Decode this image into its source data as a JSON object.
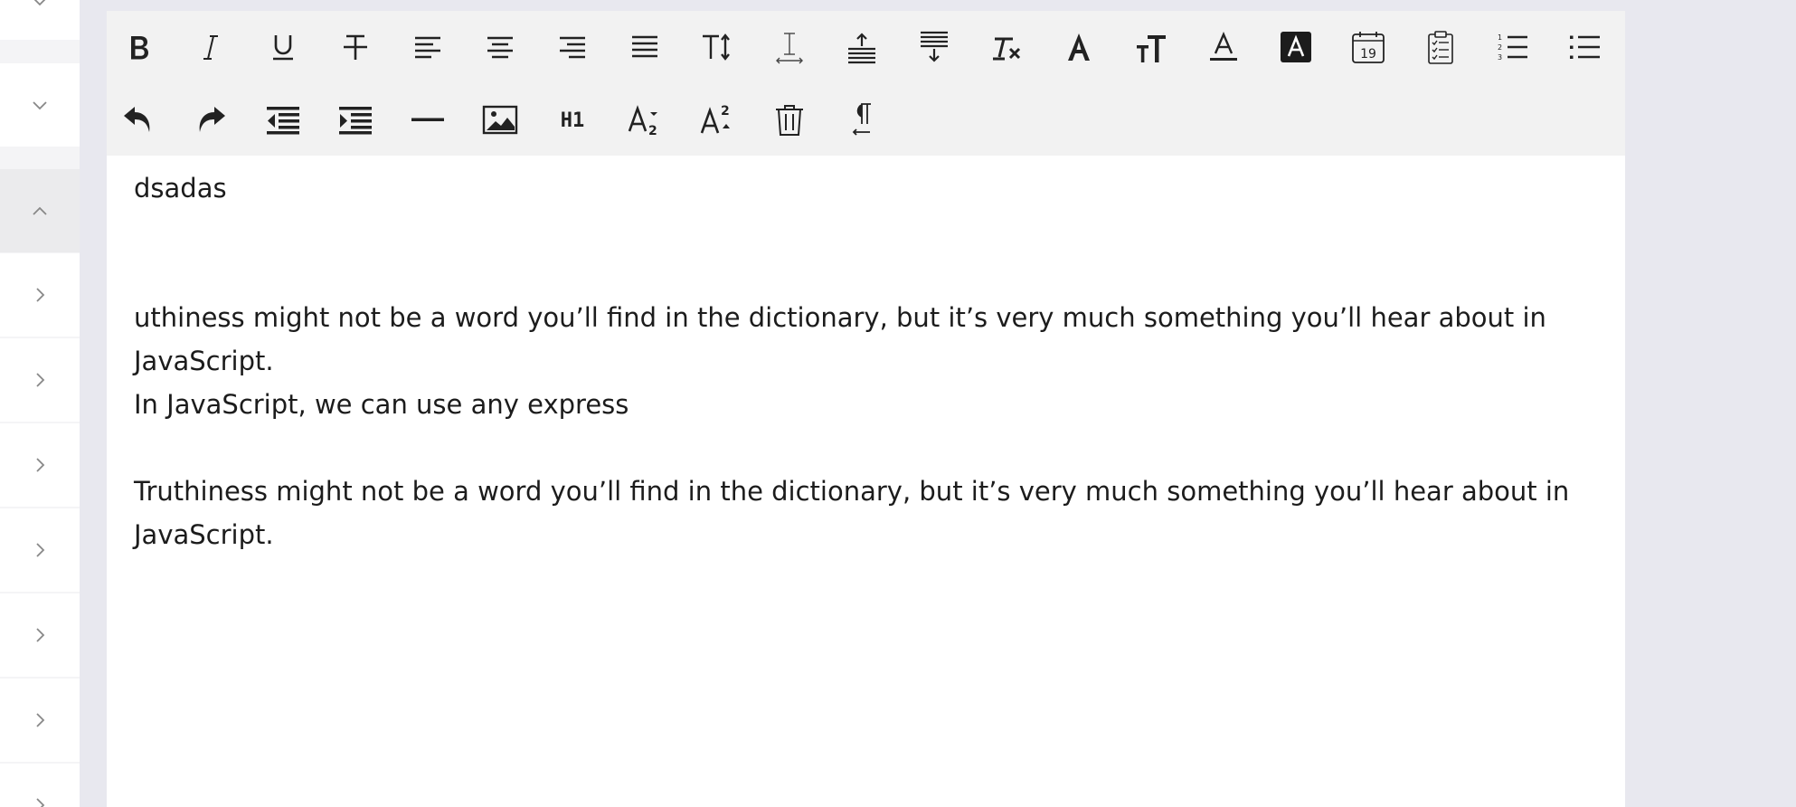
{
  "toolbar": {
    "row1": [
      {
        "name": "bold-icon"
      },
      {
        "name": "italic-icon"
      },
      {
        "name": "underline-icon"
      },
      {
        "name": "strikethrough-icon"
      },
      {
        "name": "align-left-icon"
      },
      {
        "name": "align-center-icon"
      },
      {
        "name": "align-right-icon"
      },
      {
        "name": "align-justify-icon"
      },
      {
        "name": "font-size-icon"
      },
      {
        "name": "letter-spacing-icon"
      },
      {
        "name": "line-height-up-icon"
      },
      {
        "name": "line-height-down-icon"
      },
      {
        "name": "clear-format-icon"
      },
      {
        "name": "font-family-icon"
      },
      {
        "name": "text-size-icon"
      },
      {
        "name": "font-color-icon"
      },
      {
        "name": "background-color-icon"
      },
      {
        "name": "calendar-icon",
        "text": "19"
      },
      {
        "name": "clipboard-icon"
      },
      {
        "name": "ordered-list-icon"
      },
      {
        "name": "unordered-list-icon"
      }
    ],
    "row2": [
      {
        "name": "undo-icon"
      },
      {
        "name": "redo-icon"
      },
      {
        "name": "outdent-icon"
      },
      {
        "name": "indent-icon"
      },
      {
        "name": "horizontal-rule-icon"
      },
      {
        "name": "image-icon"
      },
      {
        "name": "heading-icon",
        "text": "H1"
      },
      {
        "name": "subscript-icon"
      },
      {
        "name": "superscript-icon"
      },
      {
        "name": "delete-icon"
      },
      {
        "name": "paragraph-icon"
      }
    ]
  },
  "content": {
    "p1": "dsadas",
    "p2": "uthiness might not be a word you’ll find in the dictionary, but it’s very much something you’ll hear about in JavaScript.",
    "p3": "In JavaScript, we can use any express",
    "p4": "Truthiness might not be a word you’ll find in the dictionary, but it’s very much something you’ll hear about in JavaScript."
  }
}
